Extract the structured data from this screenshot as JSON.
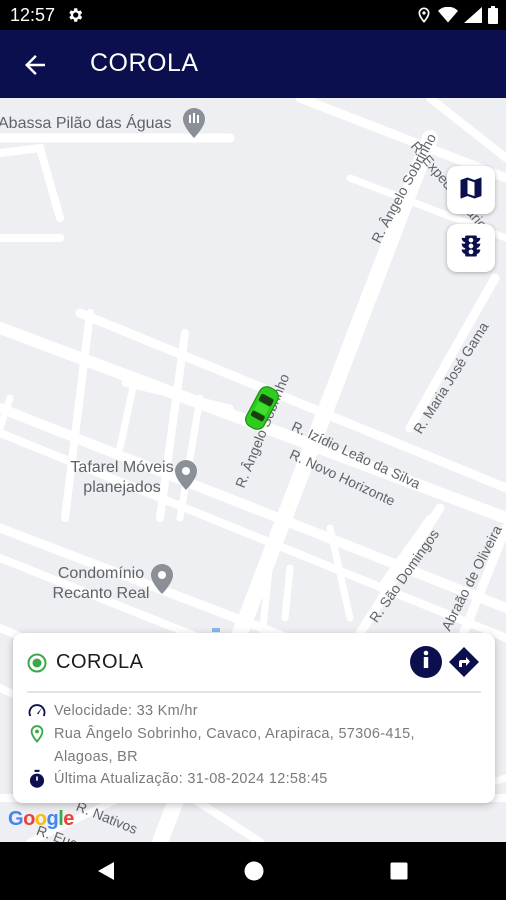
{
  "status_bar": {
    "time": "12:57"
  },
  "app_bar": {
    "title": "COROLA"
  },
  "map": {
    "labels": {
      "r_expedicionario": "R. Expedicionário",
      "r_angelo_sobrinho": "R. Ângelo Sobrinho",
      "r_maria_jose_gama": "R. Maria José Gama",
      "r_angelo_sobrinho_2": "R. Ângelo Sobrinho",
      "r_izidio": "R. Izídio Leão da Silva",
      "r_novo_horizonte": "R. Novo Horizonte",
      "r_sao_domingos": "R. São Domingos",
      "r_abraao": "Abraão de Oliveira",
      "r_nativos": "R. Nativos",
      "r_eucal": "R. Eucal"
    },
    "pois": {
      "abassa": "Abassa Pilão das Águas",
      "tafarel": "Tafarel Móveis planejados",
      "condominio": "Condomínio Recanto Real"
    },
    "google": "Google"
  },
  "card": {
    "title": "COROLA",
    "speed": "Velocidade: 33 Km/hr",
    "address": "Rua Ângelo Sobrinho, Cavaco, Arapiraca, 57306-415, Alagoas, BR",
    "updated": "Última Atualização: 31-08-2024 12:58:45"
  },
  "colors": {
    "app_bar": "#0c0f4d",
    "online": "#3aa84a",
    "car": "#2ecc1f"
  }
}
